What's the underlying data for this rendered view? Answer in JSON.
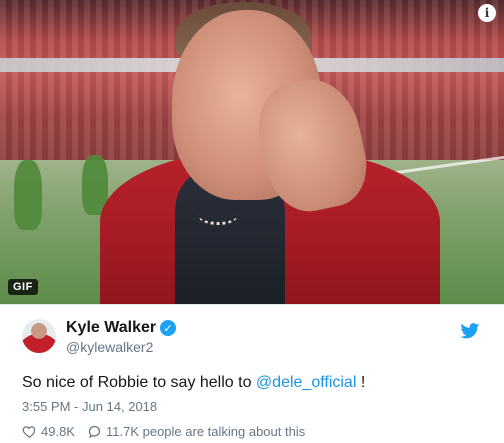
{
  "media": {
    "badge": "GIF",
    "info_glyph": "i",
    "icons": [
      "info-icon"
    ]
  },
  "tweet": {
    "author": {
      "name": "Kyle Walker",
      "handle": "@kylewalker2",
      "verified": true
    },
    "text_before": "So nice of Robbie to say hello to ",
    "mention": "@dele_official",
    "text_after": " !",
    "timestamp": "3:55 PM - Jun 14, 2018",
    "likes": "49.8K",
    "replies_text": "11.7K people are talking about this",
    "icons": [
      "verified-icon",
      "twitter-bird-icon",
      "heart-icon",
      "speech-bubble-icon"
    ],
    "colors": {
      "link": "#1b95e0",
      "verified": "#1da1f2",
      "name": "#14171a",
      "secondary": "#657786"
    }
  }
}
